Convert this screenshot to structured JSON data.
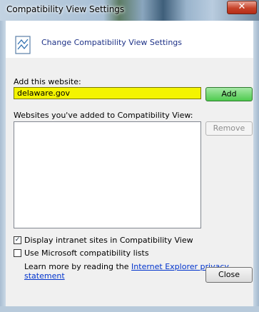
{
  "window": {
    "title": "Compatibility View Settings",
    "close_glyph": "✕"
  },
  "header": {
    "icon": "compatibility-icon",
    "text": "Change Compatibility View Settings"
  },
  "add_section": {
    "label": "Add this website:",
    "value": "delaware.gov",
    "add_label": "Add"
  },
  "list_section": {
    "label": "Websites you've added to Compatibility View:",
    "items": [],
    "remove_label": "Remove"
  },
  "options": {
    "intranet": {
      "label": "Display intranet sites in Compatibility View",
      "checked": true
    },
    "ms_lists": {
      "label": "Use Microsoft compatibility lists",
      "checked": false
    }
  },
  "footer": {
    "learn_text": "Learn more by reading the ",
    "privacy_link": "Internet Explorer privacy statement",
    "close_label": "Close"
  },
  "colors": {
    "input_highlight": "#f4f400",
    "add_button": "#4ecb4e",
    "link": "#0033cc"
  }
}
